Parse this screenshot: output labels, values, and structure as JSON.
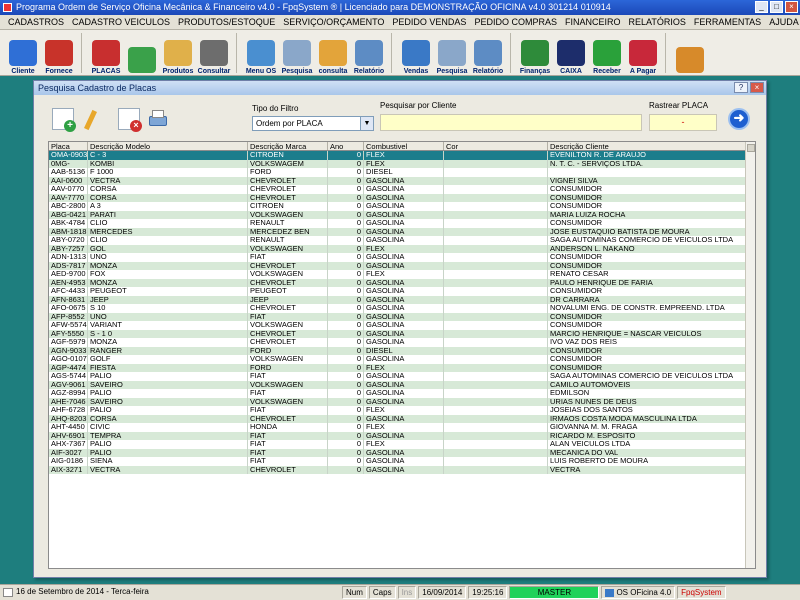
{
  "window": {
    "title": "Programa Ordem de Serviço Oficina Mecânica & Financeiro v4.0 - FpqSystem ® | Licenciado para  DEMONSTRAÇÃO OFICINA v4.0 301214 010914"
  },
  "menu": [
    "CADASTROS",
    "CADASTRO VEICULOS",
    "PRODUTOS/ESTOQUE",
    "SERVIÇO/ORÇAMENTO",
    "PEDIDO VENDAS",
    "PEDIDO COMPRAS",
    "FINANCEIRO",
    "RELATÓRIOS",
    "FERRAMENTAS",
    "AJUDA"
  ],
  "toolbar": [
    {
      "label": "Cliente",
      "icon": "person-blue-icon",
      "color": "#2f6fd6"
    },
    {
      "label": "Fornece",
      "icon": "person-red-icon",
      "color": "#c8332a"
    },
    {
      "label": "PLACAS",
      "icon": "car-icon",
      "color": "#c82f2f"
    },
    {
      "label": "",
      "icon": "calendar-clock-icon",
      "color": "#3aa14a"
    },
    {
      "label": "Produtos",
      "icon": "boxes-icon",
      "color": "#e0b04a"
    },
    {
      "label": "Consultar",
      "icon": "disk-icon",
      "color": "#6d6d6d"
    },
    {
      "label": "Menu OS",
      "icon": "clipboard-icon",
      "color": "#4a8fd0"
    },
    {
      "label": "Pesquisa",
      "icon": "magnifier-icon",
      "color": "#8aa7c9"
    },
    {
      "label": "consulta",
      "icon": "folder-icon",
      "color": "#e3a43a"
    },
    {
      "label": "Relatório",
      "icon": "printer-icon",
      "color": "#5d8cc4"
    },
    {
      "label": "Vendas",
      "icon": "monitor-icon",
      "color": "#3a79c6"
    },
    {
      "label": "Pesquisa",
      "icon": "magnifier-icon",
      "color": "#8aa7c9"
    },
    {
      "label": "Relatório",
      "icon": "printer-icon",
      "color": "#5d8cc4"
    },
    {
      "label": "Finanças",
      "icon": "money-bag-icon",
      "color": "#2e8b3a"
    },
    {
      "label": "CAIXA",
      "icon": "book-icon",
      "color": "#1d2d6b"
    },
    {
      "label": "Receber",
      "icon": "dollar-green-icon",
      "color": "#2aa13a"
    },
    {
      "label": "A Pagar",
      "icon": "dollar-red-icon",
      "color": "#c8283a"
    },
    {
      "label": "",
      "icon": "exit-door-icon",
      "color": "#d78a2a"
    }
  ],
  "dialog": {
    "title": "Pesquisa Cadastro de Placas",
    "filter_label": "Tipo do Filtro",
    "filter_value": "Ordem por PLACA",
    "search_client_label": "Pesquisar por Cliente",
    "search_client_value": "",
    "track_label": "Rastrear PLACA",
    "track_value": "-"
  },
  "columns": [
    "Placa",
    "Descrição Modelo",
    "Descrição Marca",
    "Ano",
    "Combustivel",
    "Cor",
    "Descrição Cliente"
  ],
  "rows": [
    [
      "OMA-0903",
      "C - 3",
      "CITROEN",
      "0",
      "FLEX",
      "",
      "EVENILTON R. DE ARAUJO"
    ],
    [
      "0MG-",
      "KOMBI",
      "VOLKSWAGEM",
      "0",
      "FLEX",
      "",
      "N. T. C. - SERVIÇOS LTDA."
    ],
    [
      "AAB-5136",
      "F 1000",
      "FORD",
      "0",
      "DIESEL",
      "",
      ""
    ],
    [
      "AAI-0600",
      "VECTRA",
      "CHEVROLET",
      "0",
      "GASOLINA",
      "",
      "VIGNEI SILVA"
    ],
    [
      "AAV-0770",
      "CORSA",
      "CHEVROLET",
      "0",
      "GASOLINA",
      "",
      "CONSUMIDOR"
    ],
    [
      "AAV-7770",
      "CORSA",
      "CHEVROLET",
      "0",
      "GASOLINA",
      "",
      "CONSUMIDOR"
    ],
    [
      "ABC-2800",
      "A 3",
      "CITROEN",
      "0",
      "GASOLINA",
      "",
      "CONSUMIDOR"
    ],
    [
      "ABG-0421",
      "PARATI",
      "VOLKSWAGEN",
      "0",
      "GASOLINA",
      "",
      "MARIA LUIZA ROCHA"
    ],
    [
      "ABK-4784",
      "CLIO",
      "RENAULT",
      "0",
      "GASOLINA",
      "",
      "CONSUMIDOR"
    ],
    [
      "ABM-1818",
      "MERCEDES",
      "MERCEDEZ BEN",
      "0",
      "GASOLINA",
      "",
      "JOSE EUSTAQUIO BATISTA DE MOURA"
    ],
    [
      "ABY-0720",
      "CLIO",
      "RENAULT",
      "0",
      "GASOLINA",
      "",
      "SAGA AUTOMINAS COMERCIO DE VEICULOS LTDA"
    ],
    [
      "ABY-7257",
      "GOL",
      "VOLKSWAGEN",
      "0",
      "FLEX",
      "",
      "ANDERSON L. NAKANO"
    ],
    [
      "ADN-1313",
      "UNO",
      "FIAT",
      "0",
      "GASOLINA",
      "",
      "CONSUMIDOR"
    ],
    [
      "ADS-7817",
      "MONZA",
      "CHEVROLET",
      "0",
      "GASOLINA",
      "",
      "CONSUMIDOR"
    ],
    [
      "AED-9700",
      "FOX",
      "VOLKSWAGEN",
      "0",
      "FLEX",
      "",
      "RENATO CESAR"
    ],
    [
      "AEN-4953",
      "MONZA",
      "CHEVROLET",
      "0",
      "GASOLINA",
      "",
      "PAULO HENRIQUE DE FARIA"
    ],
    [
      "AFC-4433",
      "PEUGEOT",
      "PEUGEOT",
      "0",
      "GASOLINA",
      "",
      "CONSUMIDOR"
    ],
    [
      "AFN-8631",
      "JEEP",
      "JEEP",
      "0",
      "GASOLINA",
      "",
      "DR CARRARA"
    ],
    [
      "AFO-0675",
      "S 10",
      "CHEVROLET",
      "0",
      "GASOLINA",
      "",
      "NOVALUMI ENG. DE CONSTR. EMPREEND. LTDA"
    ],
    [
      "AFP-8552",
      "UNO",
      "FIAT",
      "0",
      "GASOLINA",
      "",
      "CONSUMIDOR"
    ],
    [
      "AFW-5574",
      "VARIANT",
      "VOLKSWAGEN",
      "0",
      "GASOLINA",
      "",
      "CONSUMIDOR"
    ],
    [
      "AFY-5550",
      "S - 1 0",
      "CHEVROLET",
      "0",
      "GASOLINA",
      "",
      "MARCIO HENRIQUE = NASCAR VEICULOS"
    ],
    [
      "AGF-5979",
      "MONZA",
      "CHEVROLET",
      "0",
      "GASOLINA",
      "",
      "IVO VAZ DOS REIS"
    ],
    [
      "AGN-9033",
      "RANGER",
      "FORD",
      "0",
      "DIESEL",
      "",
      "CONSUMIDOR"
    ],
    [
      "AGO-0107",
      "GOLF",
      "VOLKSWAGEN",
      "0",
      "GASOLINA",
      "",
      "CONSUMIDOR"
    ],
    [
      "AGP-4474",
      "FIESTA",
      "FORD",
      "0",
      "FLEX",
      "",
      "CONSUMIDOR"
    ],
    [
      "AGS-5744",
      "PALIO",
      "FIAT",
      "0",
      "GASOLINA",
      "",
      "SAGA AUTOMINAS COMERCIO DE VEICULOS LTDA"
    ],
    [
      "AGV-9061",
      "SAVEIRO",
      "VOLKSWAGEN",
      "0",
      "GASOLINA",
      "",
      "CAMILO AUTOMÓVEIS"
    ],
    [
      "AGZ-8994",
      "PALIO",
      "FIAT",
      "0",
      "GASOLINA",
      "",
      "EDMILSON"
    ],
    [
      "AHE-7046",
      "SAVEIRO",
      "VOLKSWAGEN",
      "0",
      "GASOLINA",
      "",
      "URIAS NUNES DE DEUS"
    ],
    [
      "AHF-6728",
      "PALIO",
      "FIAT",
      "0",
      "FLEX",
      "",
      "JOSEIAS DOS SANTOS"
    ],
    [
      "AHQ-8203",
      "CORSA",
      "CHEVROLET",
      "0",
      "GASOLINA",
      "",
      "IRMAOS COSTA MODA MASCULINA LTDA"
    ],
    [
      "AHT-4450",
      "CIVIC",
      "HONDA",
      "0",
      "FLEX",
      "",
      "GIOVANNA M. M. FRAGA"
    ],
    [
      "AHV-6901",
      "TEMPRA",
      "FIAT",
      "0",
      "GASOLINA",
      "",
      "RICARDO M. ESPOSITO"
    ],
    [
      "AHX-7367",
      "PALIO",
      "FIAT",
      "0",
      "FLEX",
      "",
      "ALAN VEICULOS LTDA"
    ],
    [
      "AIF-3027",
      "PALIO",
      "FIAT",
      "0",
      "GASOLINA",
      "",
      "MECANICA DO VAL"
    ],
    [
      "AIG-0186",
      "SIENA",
      "FIAT",
      "0",
      "GASOLINA",
      "",
      "LUIS ROBERTO DE MOURA"
    ],
    [
      "AIX-3271",
      "VECTRA",
      "CHEVROLET",
      "0",
      "GASOLINA",
      "",
      "VECTRA"
    ]
  ],
  "status": {
    "date_long": "16 de Setembro de 2014 - Terca-feira",
    "num": "Num",
    "caps": "Caps",
    "ins": "Ins",
    "date": "16/09/2014",
    "time": "19:25:16",
    "user": "MASTER",
    "app": "OS OFicina 4.0",
    "brand": "FpqSystem"
  }
}
